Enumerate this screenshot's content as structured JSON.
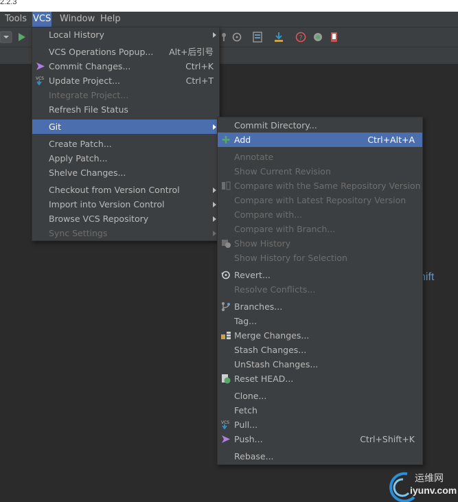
{
  "version_text": "2.2.3",
  "menubar": {
    "items": [
      {
        "label": "Tools"
      },
      {
        "label": "VCS"
      },
      {
        "label": "Window"
      },
      {
        "label": "Help"
      }
    ]
  },
  "toolbar": {
    "icons": [
      "dropdown-icon",
      "run-icon",
      "pin-icon",
      "history-icon",
      "list-icon",
      "download-icon",
      "help-icon",
      "record-icon",
      "phone-icon"
    ]
  },
  "vcs_menu": {
    "items": [
      {
        "label": "Local History",
        "has_submenu": true
      },
      {
        "label": "VCS Operations Popup...",
        "shortcut": "Alt+后引号"
      },
      {
        "label": "Commit Changes...",
        "shortcut": "Ctrl+K",
        "icon": "commit-arrow-icon"
      },
      {
        "label": "Update Project...",
        "shortcut": "Ctrl+T",
        "icon": "vcs-update-icon"
      },
      {
        "label": "Integrate Project...",
        "disabled": true
      },
      {
        "label": "Refresh File Status"
      },
      {
        "label": "Git",
        "has_submenu": true,
        "selected": true
      },
      {
        "label": "Create Patch..."
      },
      {
        "label": "Apply Patch..."
      },
      {
        "label": "Shelve Changes..."
      },
      {
        "label": "Checkout from Version Control",
        "has_submenu": true
      },
      {
        "label": "Import into Version Control",
        "has_submenu": true
      },
      {
        "label": "Browse VCS Repository",
        "has_submenu": true
      },
      {
        "label": "Sync Settings",
        "has_submenu": true,
        "disabled": true
      }
    ]
  },
  "git_menu": {
    "items": [
      {
        "label": "Commit Directory..."
      },
      {
        "label": "Add",
        "shortcut": "Ctrl+Alt+A",
        "selected": true,
        "icon": "add-icon"
      },
      {
        "label": "Annotate",
        "disabled": true
      },
      {
        "label": "Show Current Revision",
        "disabled": true
      },
      {
        "label": "Compare with the Same Repository Version",
        "disabled": true,
        "icon": "compare-icon"
      },
      {
        "label": "Compare with Latest Repository Version",
        "disabled": true
      },
      {
        "label": "Compare with...",
        "disabled": true
      },
      {
        "label": "Compare with Branch...",
        "disabled": true
      },
      {
        "label": "Show History",
        "disabled": true,
        "icon": "show-history-icon"
      },
      {
        "label": "Show History for Selection",
        "disabled": true
      },
      {
        "label": "Revert...",
        "icon": "revert-icon"
      },
      {
        "label": "Resolve Conflicts...",
        "disabled": true
      },
      {
        "label": "Branches...",
        "icon": "branches-icon"
      },
      {
        "label": "Tag..."
      },
      {
        "label": "Merge Changes...",
        "icon": "merge-icon"
      },
      {
        "label": "Stash Changes..."
      },
      {
        "label": "UnStash Changes..."
      },
      {
        "label": "Reset HEAD...",
        "icon": "reset-head-icon"
      },
      {
        "label": "Clone..."
      },
      {
        "label": "Fetch"
      },
      {
        "label": "Pull...",
        "icon": "vcs-pull-icon"
      },
      {
        "label": "Push...",
        "shortcut": "Ctrl+Shift+K",
        "icon": "push-arrow-icon"
      },
      {
        "label": "Rebase..."
      }
    ]
  },
  "background": {
    "partial_text": "hift"
  },
  "watermark": {
    "cn_text": "运维网",
    "url_text": "iyunv.com"
  },
  "colors": {
    "menu_bg": "#3c3f41",
    "editor_bg": "#2b2b2b",
    "selection": "#4b6eaf",
    "text": "#bbbbbb",
    "disabled_text": "#6e6e6e"
  }
}
